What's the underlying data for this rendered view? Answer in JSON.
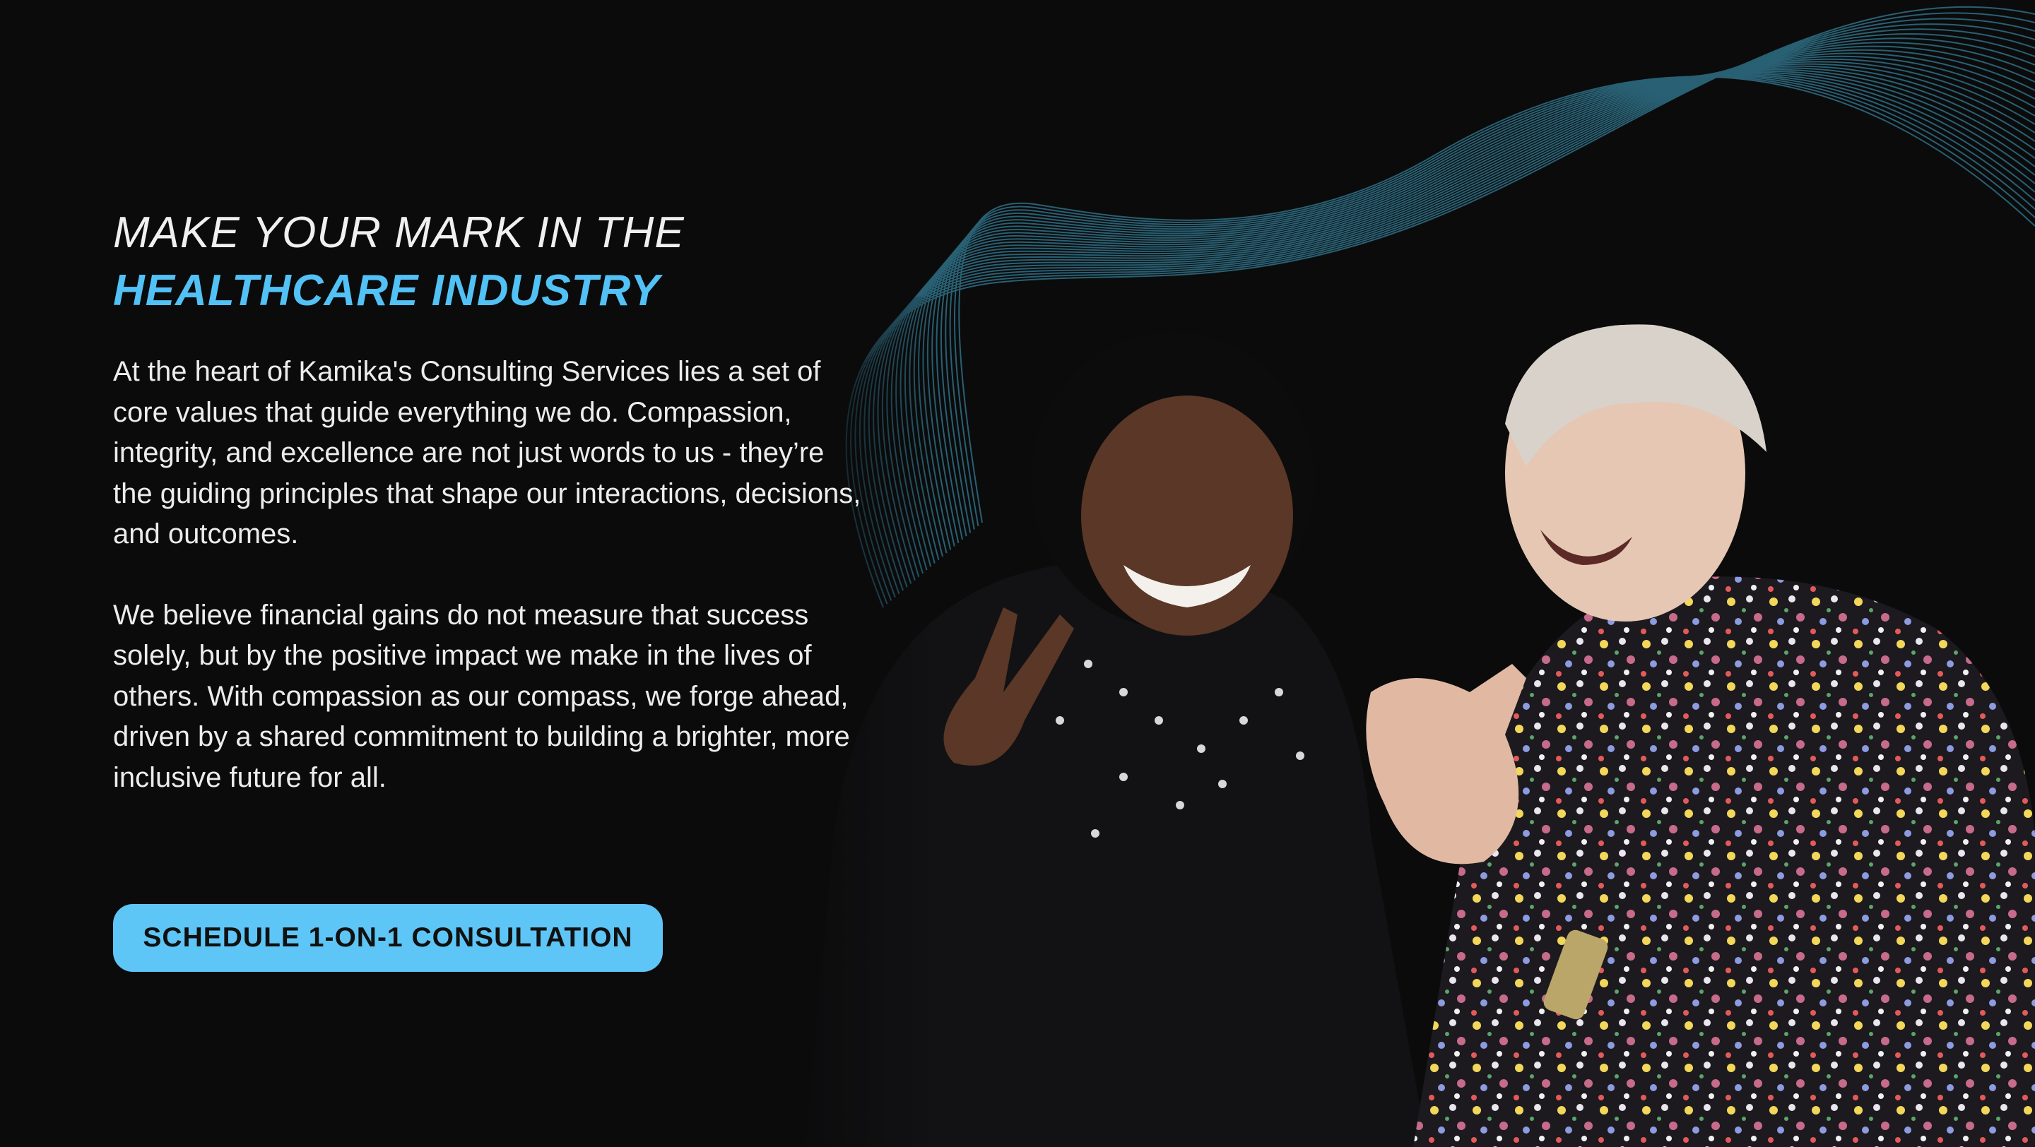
{
  "hero": {
    "headline_line1": "MAKE YOUR MARK IN THE",
    "headline_line2": "HEALTHCARE INDUSTRY",
    "paragraph1": "At the heart of Kamika's Consulting Services lies a set of core values that guide everything we do. Compassion, integrity, and excellence are not just words to us - they’re the guiding principles that shape our interactions, decisions, and outcomes.",
    "paragraph2": "We believe financial gains do not measure that success solely, but by the positive impact we make in the lives of others. With compassion as our compass, we forge ahead, driven by a shared commitment to building a brighter, more inclusive future for all.",
    "cta_label": "SCHEDULE 1-ON-1 CONSULTATION"
  },
  "colors": {
    "background": "#0b0b0c",
    "accent": "#52c1f5",
    "button": "#5ec6f6",
    "wave_lines": "#2f6f85"
  }
}
